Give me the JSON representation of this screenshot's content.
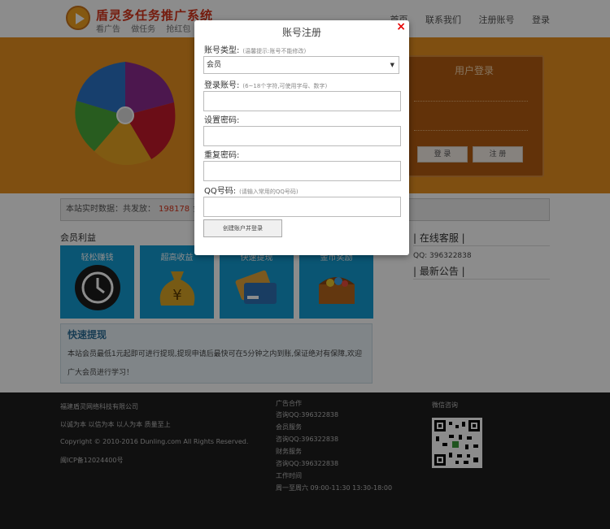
{
  "header": {
    "title": "盾灵多任务推广系统",
    "sub_links": [
      "看广告",
      "做任务",
      "抢红包"
    ],
    "nav": [
      "首页",
      "联系我们",
      "注册账号",
      "登录"
    ]
  },
  "login_panel": {
    "title": "用户登录",
    "login_button": "登 录",
    "register_button": "注 册"
  },
  "stats": {
    "prefix": "本站实时数据：共发放：",
    "value": "198178",
    "suffix": "金币"
  },
  "benefits": {
    "title": "会员利益",
    "tiles": [
      "轻松赚钱",
      "超高收益",
      "快速提现",
      "金币奖励"
    ]
  },
  "withdraw": {
    "title": "快速提现",
    "text": "本站会员最低1元起即可进行提现,提现申请后最快可在5分钟之内到账,保证绝对有保障,欢迎广大会员进行学习！"
  },
  "side": {
    "service_title": "| 在线客服 |",
    "qq": "QQ: 396322838",
    "notice_title": "| 最新公告 |"
  },
  "footer": {
    "company": "福建盾灵网络科技有限公司",
    "slogan": "以诚为本 以信为本 以人为本 质量至上",
    "copyright": "Copyright © 2010-2016 Dunling.com All Rights Reserved.",
    "icp": "闽ICP备12024400号",
    "contact_lines": [
      "广告合作",
      "咨询QQ:396322838",
      "会员服务",
      "咨询QQ:396322838",
      "财务服务",
      "咨询QQ:396322838",
      "工作时间",
      "周一至周六 09:00-11:30 13:30-18:00"
    ],
    "wechat_title": "微信咨询"
  },
  "modal": {
    "title": "账号注册",
    "close": "×",
    "account_type_label": "账号类型:",
    "account_type_hint": "(温馨提示:账号不能修改)",
    "account_type_value": "会员",
    "account_label": "登录账号:",
    "account_hint": "(6~18个字符,可使用字母、数字)",
    "password_label": "设置密码:",
    "repeat_label": "重复密码:",
    "qq_label": "QQ号码:",
    "qq_hint": "(请输入常用的QQ号码)",
    "submit": "创建账户并登录"
  }
}
